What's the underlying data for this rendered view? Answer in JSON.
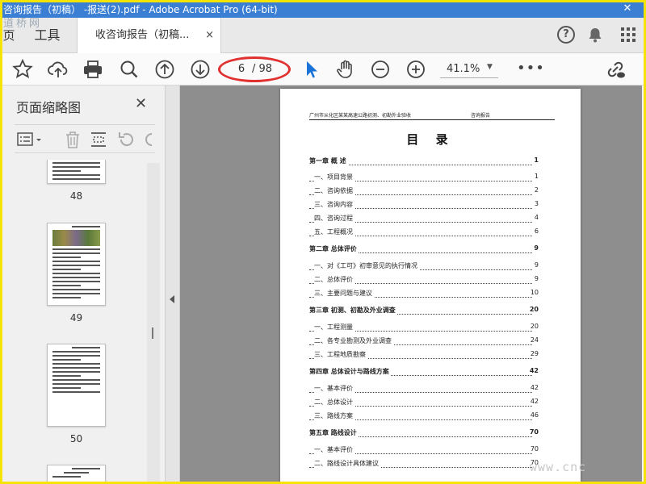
{
  "window": {
    "title": "咨询报告（初稿） -报送(2).pdf - Adobe Acrobat Pro (64-bit)",
    "close_glyph": "✕",
    "watermark": "道桥网"
  },
  "tabs": {
    "home": "页",
    "tools": "工具",
    "document": "收咨询报告（初稿...",
    "close_glyph": "×",
    "help_glyph": "?"
  },
  "toolbar": {
    "current_page": "6",
    "total_pages": "/ 98",
    "zoom": "41.1%",
    "more_glyph": "•••"
  },
  "sidebar": {
    "title": "页面缩略图",
    "close_glyph": "✕",
    "thumbnails": [
      {
        "label": "48"
      },
      {
        "label": "49"
      },
      {
        "label": "50"
      }
    ]
  },
  "document": {
    "header_left": "广州市从化区某某高速公路初测、初勘外业验收",
    "header_right": "咨询报告",
    "title": "目 录",
    "toc": [
      {
        "label": "第一章 概 述",
        "page": "1",
        "level": "chapter"
      },
      {
        "label": "一、项目背景",
        "page": "1",
        "level": "section"
      },
      {
        "label": "二、咨询依据",
        "page": "2",
        "level": "section"
      },
      {
        "label": "三、咨询内容",
        "page": "3",
        "level": "section"
      },
      {
        "label": "四、咨询过程",
        "page": "4",
        "level": "section"
      },
      {
        "label": "五、工程概况",
        "page": "6",
        "level": "section"
      },
      {
        "label": "第二章 总体评价",
        "page": "9",
        "level": "chapter"
      },
      {
        "label": "一、对《工可》初审意见的执行情况",
        "page": "9",
        "level": "section"
      },
      {
        "label": "二、总体评价",
        "page": "9",
        "level": "section"
      },
      {
        "label": "三、主要问题与建议",
        "page": "10",
        "level": "section"
      },
      {
        "label": "第三章 初测、初勘及外业调查",
        "page": "20",
        "level": "chapter"
      },
      {
        "label": "一、工程测量",
        "page": "20",
        "level": "section"
      },
      {
        "label": "二、各专业勘测及外业调查",
        "page": "24",
        "level": "section"
      },
      {
        "label": "三、工程地质勘察",
        "page": "29",
        "level": "section"
      },
      {
        "label": "第四章 总体设计与路线方案",
        "page": "42",
        "level": "chapter"
      },
      {
        "label": "一、基本评价",
        "page": "42",
        "level": "section"
      },
      {
        "label": "二、总体设计",
        "page": "42",
        "level": "section"
      },
      {
        "label": "三、路线方案",
        "page": "46",
        "level": "section"
      },
      {
        "label": "第五章 路线设计",
        "page": "70",
        "level": "chapter"
      },
      {
        "label": "一、基本评价",
        "page": "70",
        "level": "section"
      },
      {
        "label": "二、路线设计具体建议",
        "page": "70",
        "level": "section"
      }
    ]
  },
  "watermark_br": "www.cnc",
  "colors": {
    "titlebar": "#3b7fd4",
    "frame": "#f5e400",
    "highlight_ellipse": "#e03030",
    "select_tool": "#1a73d9"
  }
}
